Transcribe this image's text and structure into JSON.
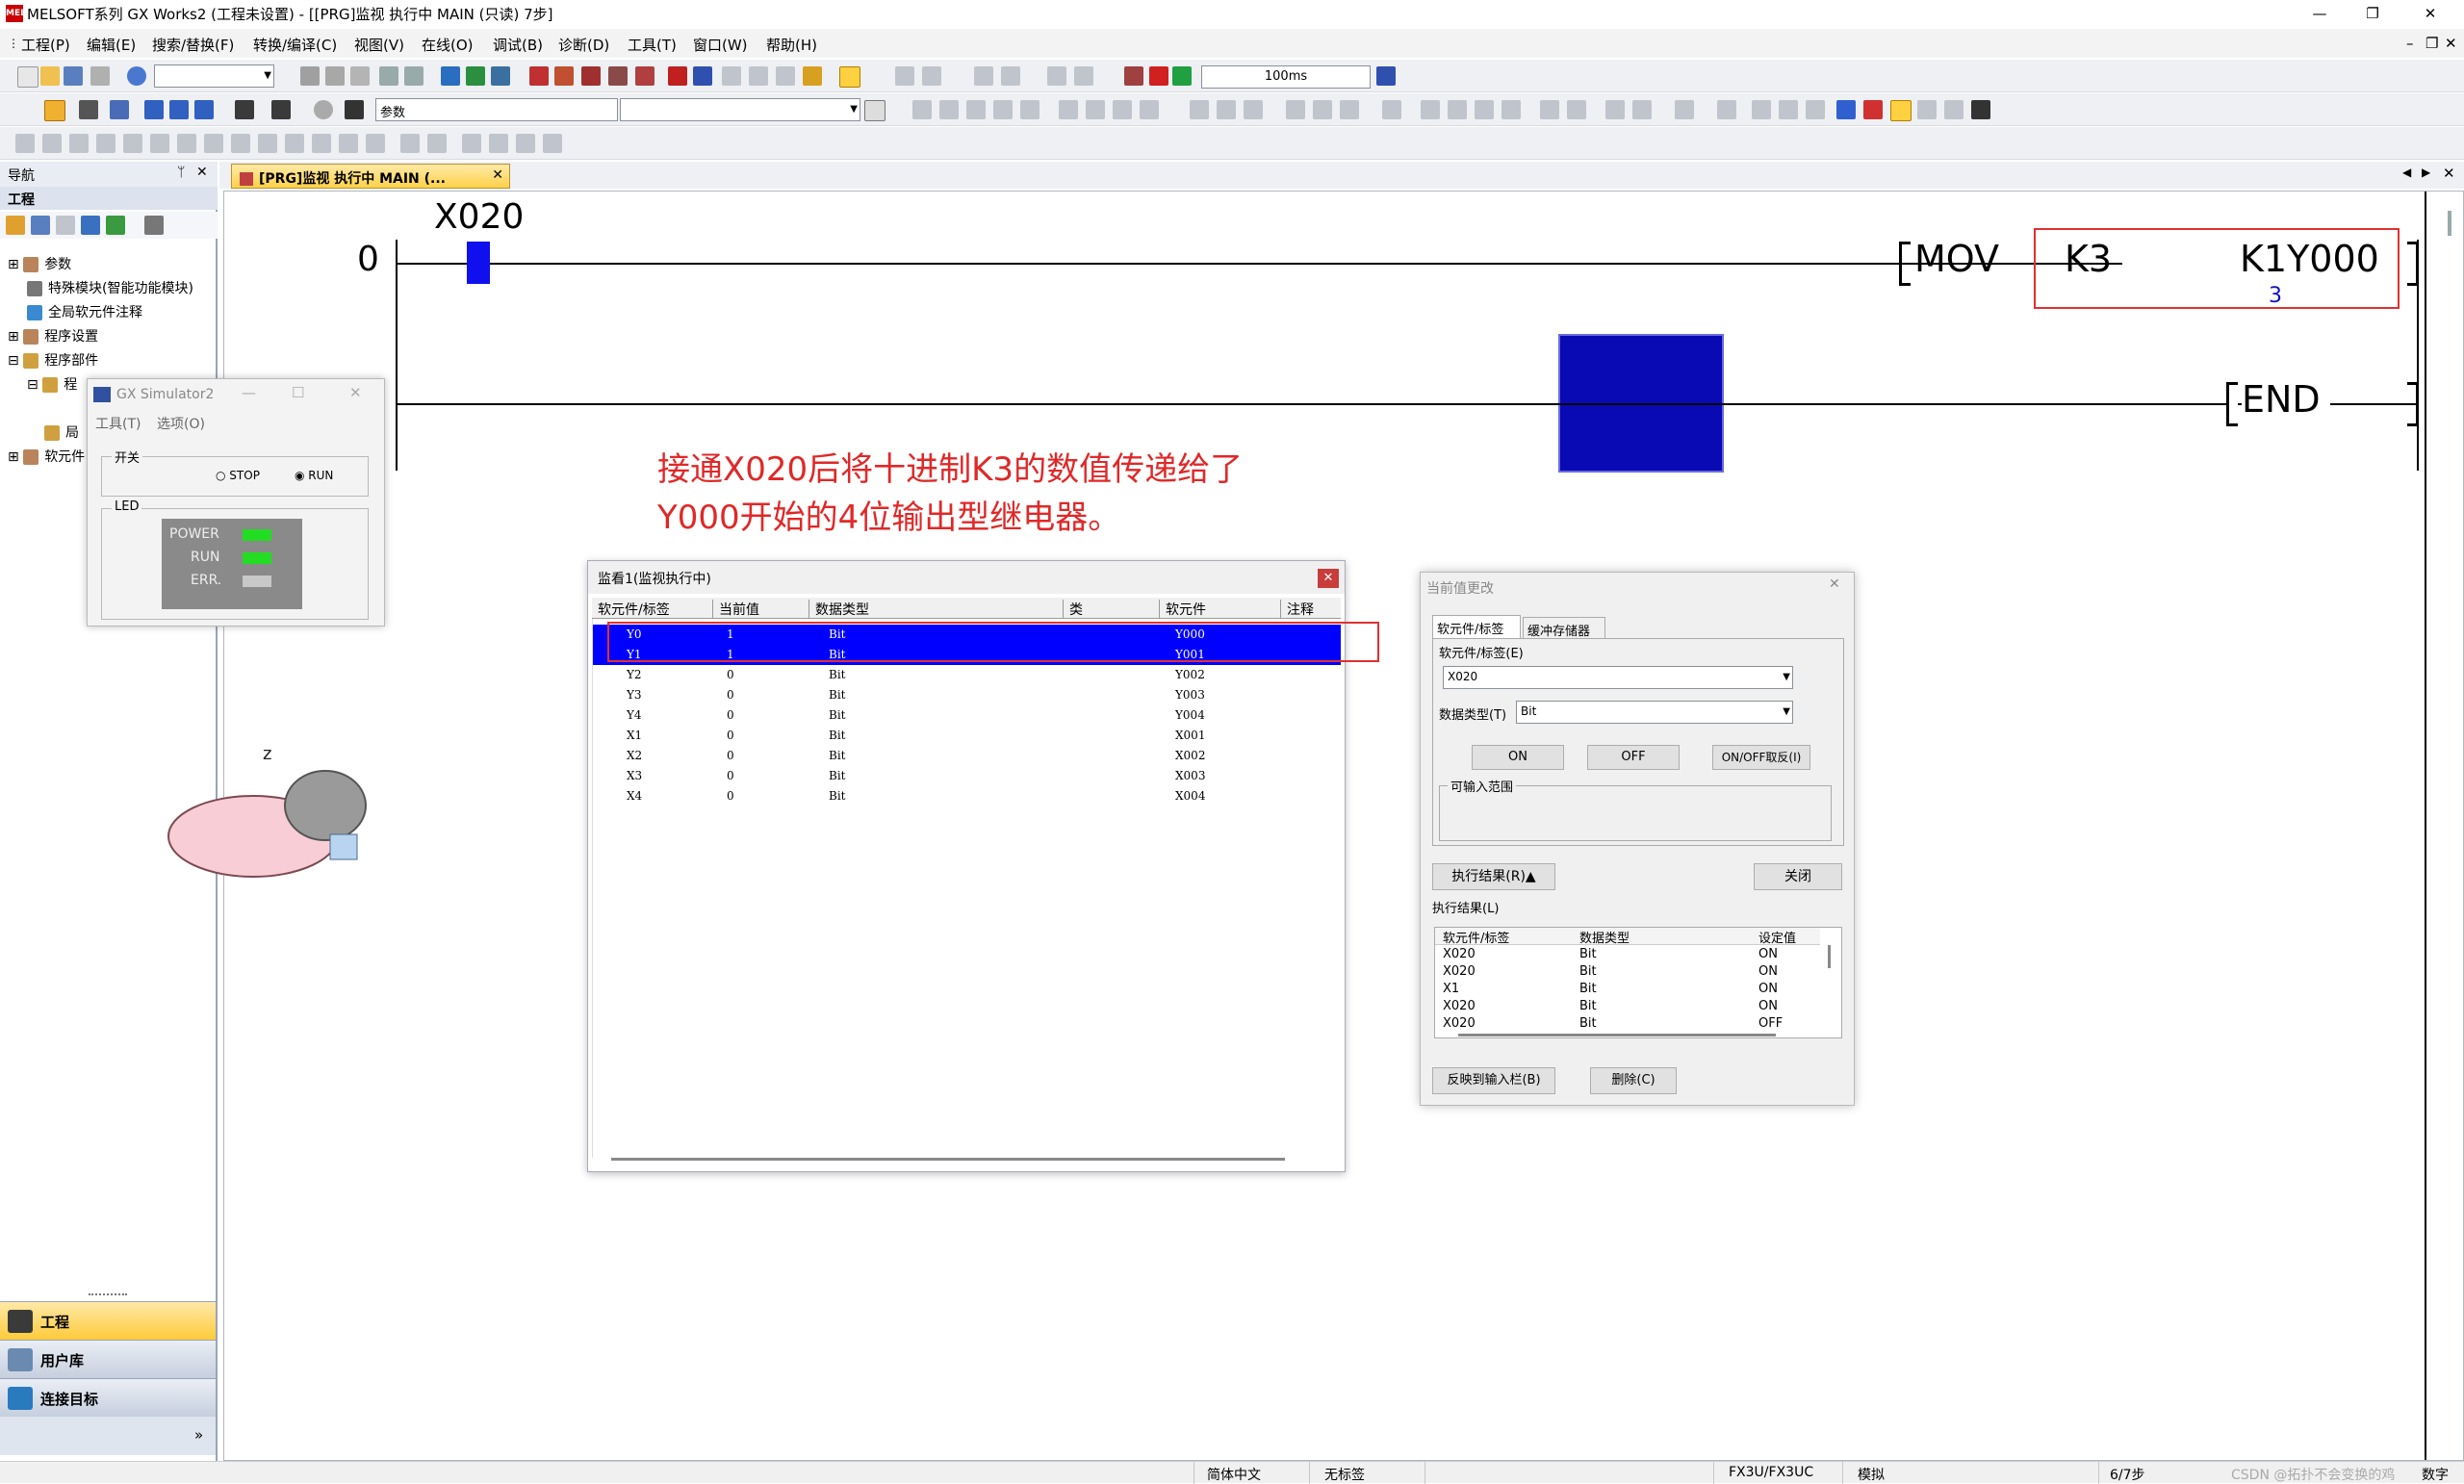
{
  "window": {
    "title": "MELSOFT系列 GX Works2 (工程未设置) - [[PRG]监视 执行中 MAIN (只读) 7步]",
    "app_icon_text": "MEL"
  },
  "menubar": [
    "工程(P)",
    "编辑(E)",
    "搜索/替换(F)",
    "转换/编译(C)",
    "视图(V)",
    "在线(O)",
    "调试(B)",
    "诊断(D)",
    "工具(T)",
    "窗口(W)",
    "帮助(H)"
  ],
  "toolbar": {
    "scan_time": "100ms",
    "param_combo": "参数"
  },
  "nav": {
    "header": "导航",
    "section": "工程",
    "tree": [
      "参数",
      "特殊模块(智能功能模块)",
      "全局软元件注释",
      "程序设置",
      "程序部件",
      "程",
      "局",
      "软元件"
    ],
    "buttons": [
      "工程",
      "用户库",
      "连接目标"
    ]
  },
  "editor_tab": "[PRG]监视 执行中 MAIN (...",
  "ladder": {
    "rung0_step": "0",
    "contact": "X020",
    "instruction": "MOV",
    "source": "K3",
    "dest": "K1Y000",
    "dest_value": "3",
    "end": "END"
  },
  "annotation": {
    "line1": "接通X020后将十进制K3的数值传递给了",
    "line2": "Y000开始的4位输出型继电器。"
  },
  "simulator": {
    "title": "GX Simulator2",
    "menu": [
      "工具(T)",
      "选项(O)"
    ],
    "switch_group": "开关",
    "stop": "STOP",
    "run": "RUN",
    "led_group": "LED",
    "leds": [
      {
        "label": "POWER",
        "color": "#22dd22"
      },
      {
        "label": "RUN",
        "color": "#22dd22"
      },
      {
        "label": "ERR.",
        "color": "#c8c8c8"
      }
    ]
  },
  "monitor": {
    "title": "监看1(监视执行中)",
    "columns": [
      "软元件/标签",
      "当前值",
      "数据类型",
      "类",
      "软元件",
      "注释"
    ],
    "rows": [
      {
        "label": "Y0",
        "value": "1",
        "type": "Bit",
        "device": "Y000",
        "selected": true
      },
      {
        "label": "Y1",
        "value": "1",
        "type": "Bit",
        "device": "Y001",
        "selected": true
      },
      {
        "label": "Y2",
        "value": "0",
        "type": "Bit",
        "device": "Y002",
        "selected": false
      },
      {
        "label": "Y3",
        "value": "0",
        "type": "Bit",
        "device": "Y003",
        "selected": false
      },
      {
        "label": "Y4",
        "value": "0",
        "type": "Bit",
        "device": "Y004",
        "selected": false
      },
      {
        "label": "X1",
        "value": "0",
        "type": "Bit",
        "device": "X001",
        "selected": false
      },
      {
        "label": "X2",
        "value": "0",
        "type": "Bit",
        "device": "X002",
        "selected": false
      },
      {
        "label": "X3",
        "value": "0",
        "type": "Bit",
        "device": "X003",
        "selected": false
      },
      {
        "label": "X4",
        "value": "0",
        "type": "Bit",
        "device": "X004",
        "selected": false
      }
    ]
  },
  "cvc": {
    "title": "当前值更改",
    "tab1": "软元件/标签",
    "tab2": "缓冲存储器",
    "device_label": "软元件/标签(E)",
    "device_value": "X020",
    "type_label": "数据类型(T)",
    "type_value": "Bit",
    "on": "ON",
    "off": "OFF",
    "toggle": "ON/OFF取反(I)",
    "range_label": "可输入范围",
    "exec_btn": "执行结果(R)▲",
    "close_btn": "关闭",
    "result_label": "执行结果(L)",
    "result_columns": [
      "软元件/标签",
      "数据类型",
      "设定值"
    ],
    "results": [
      {
        "device": "X020",
        "type": "Bit",
        "value": "ON"
      },
      {
        "device": "X020",
        "type": "Bit",
        "value": "ON"
      },
      {
        "device": "X1",
        "type": "Bit",
        "value": "ON"
      },
      {
        "device": "X020",
        "type": "Bit",
        "value": "ON"
      },
      {
        "device": "X020",
        "type": "Bit",
        "value": "OFF"
      }
    ],
    "reflect_btn": "反映到输入栏(B)",
    "delete_btn": "删除(C)"
  },
  "statusbar": {
    "lang": "简体中文",
    "label": "无标签",
    "cpu": "FX3U/FX3UC",
    "mode": "模拟",
    "steps": "6/7步",
    "extra": "数字",
    "watermark": "CSDN @拓扑不会变换的鸡"
  }
}
